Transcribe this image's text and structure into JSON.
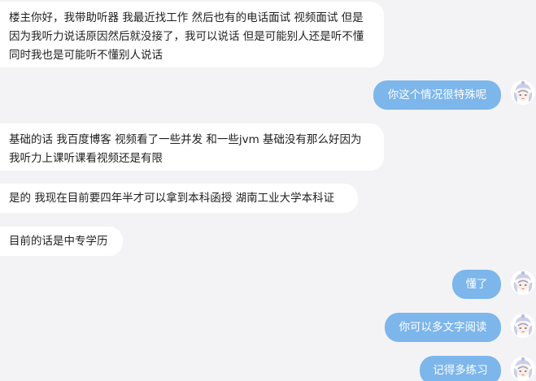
{
  "chat": {
    "messages": [
      {
        "from": "other",
        "text": "楼主你好，我带助听器 我最近找工作 然后也有的电话面试 视频面试 但是因为我听力说话原因然后就没接了，我可以说话 但是可能别人还是听不懂 同时我也是可能听不懂别人说话"
      },
      {
        "from": "self",
        "text": "你这个情况很特殊呢"
      },
      {
        "from": "other",
        "text": "基础的话 我百度博客 视频看了一些并发 和一些jvm 基础没有那么好因为我听力上课听课看视频还是有限"
      },
      {
        "from": "other",
        "text": "是的 我现在目前要四年半才可以拿到本科函授 湖南工业大学本科证"
      },
      {
        "from": "other",
        "text": "目前的话是中专学历"
      },
      {
        "from": "self",
        "text": "懂了"
      },
      {
        "from": "self",
        "text": "你可以多文字阅读"
      },
      {
        "from": "self",
        "text": "记得多练习"
      }
    ]
  },
  "colors": {
    "background": "#f3f3f5",
    "incoming_bubble": "#ffffff",
    "outgoing_bubble": "#7db6ea",
    "outgoing_text": "#ffffff"
  },
  "icons": {
    "self_avatar": "anime-avatar-icon"
  }
}
